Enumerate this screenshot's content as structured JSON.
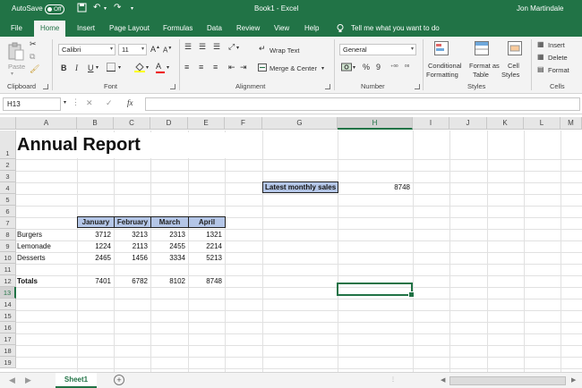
{
  "titlebar": {
    "autosave_label": "AutoSave",
    "autosave_state": "Off",
    "document_title": "Book1  -  Excel",
    "user_name": "Jon Martindale"
  },
  "tabs": [
    "File",
    "Home",
    "Insert",
    "Page Layout",
    "Formulas",
    "Data",
    "Review",
    "View",
    "Help"
  ],
  "active_tab": "Home",
  "tell_me": "Tell me what you want to do",
  "ribbon": {
    "clipboard": {
      "paste": "Paste",
      "label": "Clipboard"
    },
    "font": {
      "font_name": "Calibri",
      "font_size": "11",
      "label": "Font",
      "bold": "B",
      "italic": "I",
      "underline": "U"
    },
    "alignment": {
      "wrap_text": "Wrap Text",
      "merge_center": "Merge & Center",
      "label": "Alignment"
    },
    "number": {
      "format": "General",
      "label": "Number",
      "pct": "%",
      "comma": "9"
    },
    "styles": {
      "conditional_1": "Conditional",
      "conditional_2": "Formatting",
      "format_table_1": "Format as",
      "format_table_2": "Table",
      "cell_styles_1": "Cell",
      "cell_styles_2": "Styles",
      "label": "Styles"
    },
    "cells": {
      "insert": "Insert",
      "delete": "Delete",
      "format": "Format",
      "label": "Cells"
    }
  },
  "formula_bar": {
    "name_box": "H13",
    "fx": "fx",
    "cancel": "✕",
    "enter": "✓",
    "value": ""
  },
  "grid": {
    "columns": [
      "A",
      "B",
      "C",
      "D",
      "E",
      "F",
      "G",
      "H",
      "I",
      "J",
      "K",
      "L",
      "M"
    ],
    "rows": [
      "1",
      "2",
      "3",
      "4",
      "5",
      "6",
      "7",
      "8",
      "9",
      "10",
      "11",
      "12",
      "13",
      "14",
      "15",
      "16",
      "17",
      "18",
      "19"
    ],
    "selected_column": "H",
    "selected_row": "13",
    "title": "Annual Report",
    "latest_label": "Latest monthly sales",
    "latest_value": "8748",
    "months": [
      "January",
      "February",
      "March",
      "April"
    ],
    "items": [
      {
        "name": "Burgers",
        "values": [
          "3712",
          "3213",
          "2313",
          "1321"
        ]
      },
      {
        "name": "Lemonade",
        "values": [
          "1224",
          "2113",
          "2455",
          "2214"
        ]
      },
      {
        "name": "Desserts",
        "values": [
          "2465",
          "1456",
          "3334",
          "5213"
        ]
      }
    ],
    "totals_label": "Totals",
    "totals": [
      "7401",
      "6782",
      "8102",
      "8748"
    ]
  },
  "sheets": {
    "active": "Sheet1",
    "add": "+"
  },
  "colors": {
    "accent": "#217346",
    "month_fill": "#b4c6e7"
  }
}
